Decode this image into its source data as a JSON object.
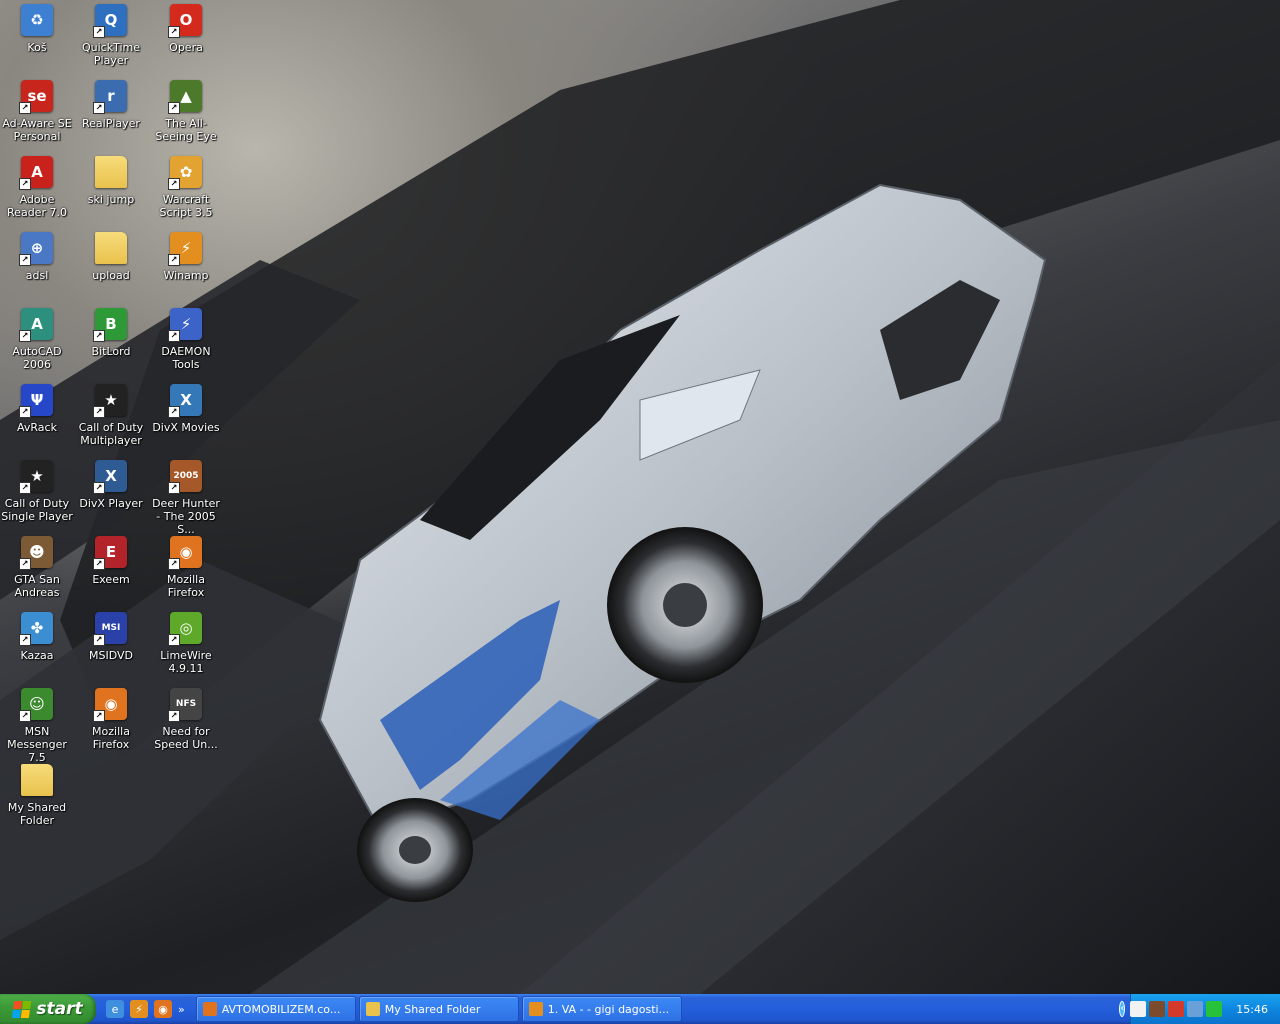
{
  "desktop_icons": [
    {
      "label": "Koš",
      "icon": "recycle-bin-icon",
      "color": "#3d7fd1",
      "glyph": "♻",
      "shortcut": false
    },
    {
      "label": "QuickTime Player",
      "icon": "quicktime-icon",
      "color": "#2f6fbf",
      "glyph": "Q",
      "shortcut": true
    },
    {
      "label": "Opera",
      "icon": "opera-icon",
      "color": "#d42a1e",
      "glyph": "O",
      "shortcut": true
    },
    {
      "label": "Ad-Aware SE Personal",
      "icon": "ad-aware-icon",
      "color": "#c8261d",
      "glyph": "se",
      "shortcut": true
    },
    {
      "label": "RealPlayer",
      "icon": "realplayer-icon",
      "color": "#3b6cb0",
      "glyph": "r",
      "shortcut": true
    },
    {
      "label": "The All-Seeing Eye",
      "icon": "all-seeing-eye-icon",
      "color": "#4c7a2a",
      "glyph": "▲",
      "shortcut": true
    },
    {
      "label": "Adobe Reader 7.0",
      "icon": "adobe-reader-icon",
      "color": "#c9211b",
      "glyph": "A",
      "shortcut": true
    },
    {
      "label": "ski jump",
      "icon": "folder-icon",
      "color": "#e9c24d",
      "glyph": "",
      "shortcut": false
    },
    {
      "label": "Warcraft Script 3.5",
      "icon": "warcraft-script-icon",
      "color": "#e3a330",
      "glyph": "✿",
      "shortcut": true
    },
    {
      "label": "adsl",
      "icon": "network-connection-icon",
      "color": "#4a78c4",
      "glyph": "⊕",
      "shortcut": true
    },
    {
      "label": "upload",
      "icon": "folder-icon",
      "color": "#e9c24d",
      "glyph": "",
      "shortcut": false
    },
    {
      "label": "Winamp",
      "icon": "winamp-icon",
      "color": "#e38f1f",
      "glyph": "⚡",
      "shortcut": true
    },
    {
      "label": "AutoCAD 2006",
      "icon": "autocad-icon",
      "color": "#2d8f7e",
      "glyph": "A",
      "shortcut": true
    },
    {
      "label": "BitLord",
      "icon": "bitlord-icon",
      "color": "#2e9a37",
      "glyph": "B",
      "shortcut": true
    },
    {
      "label": "DAEMON Tools",
      "icon": "daemon-tools-icon",
      "color": "#3c63c8",
      "glyph": "⚡",
      "shortcut": true
    },
    {
      "label": "AvRack",
      "icon": "avrack-icon",
      "color": "#2747c9",
      "glyph": "Ψ",
      "shortcut": true
    },
    {
      "label": "Call of Duty Multiplayer",
      "icon": "call-of-duty-icon",
      "color": "#222222",
      "glyph": "★",
      "shortcut": true
    },
    {
      "label": "DivX Movies",
      "icon": "divx-icon",
      "color": "#3478b8",
      "glyph": "X",
      "shortcut": true
    },
    {
      "label": "Call of Duty Single Player",
      "icon": "call-of-duty-icon",
      "color": "#222222",
      "glyph": "★",
      "shortcut": true
    },
    {
      "label": "DivX Player",
      "icon": "divx-player-icon",
      "color": "#2f5b95",
      "glyph": "X",
      "shortcut": true
    },
    {
      "label": "Deer Hunter - The 2005 S...",
      "icon": "deer-hunter-icon",
      "color": "#a5592a",
      "glyph": "2005",
      "shortcut": true
    },
    {
      "label": "GTA San Andreas",
      "icon": "gta-icon",
      "color": "#7b5a35",
      "glyph": "☻",
      "shortcut": true
    },
    {
      "label": "Exeem",
      "icon": "exeem-icon",
      "color": "#b3242a",
      "glyph": "E",
      "shortcut": true
    },
    {
      "label": "Mozilla Firefox",
      "icon": "firefox-icon",
      "color": "#e0731f",
      "glyph": "◉",
      "shortcut": true
    },
    {
      "label": "Kazaa",
      "icon": "kazaa-icon",
      "color": "#3b8ed1",
      "glyph": "✤",
      "shortcut": true
    },
    {
      "label": "MSIDVD",
      "icon": "msi-dvd-icon",
      "color": "#2941a8",
      "glyph": "MSI",
      "shortcut": true
    },
    {
      "label": "LimeWire 4.9.11",
      "icon": "limewire-icon",
      "color": "#5ea82a",
      "glyph": "◎",
      "shortcut": true
    },
    {
      "label": "MSN Messenger 7.5",
      "icon": "msn-messenger-icon",
      "color": "#3c8a2e",
      "glyph": "☺",
      "shortcut": true
    },
    {
      "label": "Mozilla Firefox",
      "icon": "firefox-icon",
      "color": "#e0731f",
      "glyph": "◉",
      "shortcut": true
    },
    {
      "label": "Need for Speed Un...",
      "icon": "need-for-speed-icon",
      "color": "#444444",
      "glyph": "NFS",
      "shortcut": true
    },
    {
      "label": "My Shared Folder",
      "icon": "shared-folder-icon",
      "color": "#e9c24d",
      "glyph": "",
      "shortcut": false
    }
  ],
  "taskbar": {
    "start_label": "start",
    "quick_launch": [
      {
        "icon": "internet-explorer-icon",
        "color": "#3f8fe0",
        "glyph": "e"
      },
      {
        "icon": "winamp-icon",
        "color": "#e38f1f",
        "glyph": "⚡"
      },
      {
        "icon": "firefox-icon",
        "color": "#e0731f",
        "glyph": "◉"
      }
    ],
    "quick_launch_more": "»",
    "tasks": [
      {
        "label": "AVTOMOBILIZEM.co...",
        "icon": "firefox-icon",
        "color": "#e0731f"
      },
      {
        "label": "My Shared Folder",
        "icon": "folder-icon",
        "color": "#e9c24d"
      },
      {
        "label": "1. VA -  - gigi dagosti...",
        "icon": "winamp-icon",
        "color": "#e38f1f"
      }
    ],
    "tray": {
      "icons": [
        {
          "icon": "avrack-tray-icon",
          "color": "#f2f2f2"
        },
        {
          "icon": "bitlord-tray-icon",
          "color": "#7a4b2c"
        },
        {
          "icon": "daemon-tray-icon",
          "color": "#d33a2c"
        },
        {
          "icon": "network-tray-icon",
          "color": "#6aa0d8"
        },
        {
          "icon": "battery-tray-icon",
          "color": "#27c23a"
        }
      ],
      "clock": "15:46",
      "expand_glyph": "‹"
    }
  }
}
